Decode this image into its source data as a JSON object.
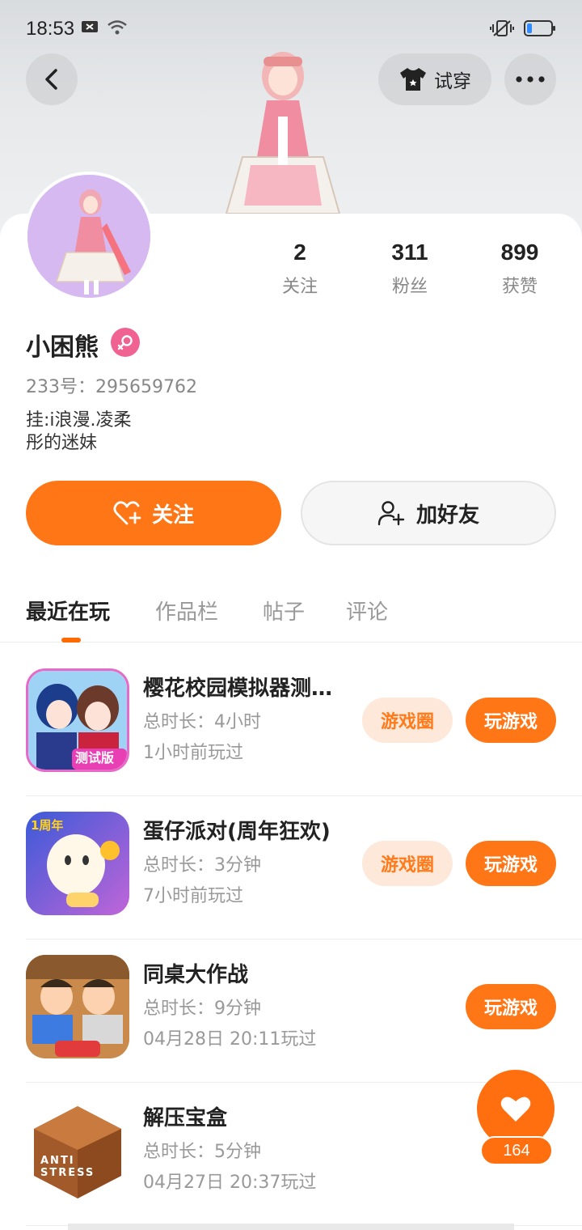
{
  "status": {
    "time": "18:53"
  },
  "header": {
    "try_on_label": "试穿"
  },
  "profile": {
    "stats": [
      {
        "num": "2",
        "label": "关注"
      },
      {
        "num": "311",
        "label": "粉丝"
      },
      {
        "num": "899",
        "label": "获赞"
      }
    ],
    "name": "小困熊",
    "uid": "233号：295659762",
    "bio_line1": "挂:i浪漫.凌柔",
    "bio_line2": "彤的迷妹",
    "follow_label": "关注",
    "add_friend_label": "加好友"
  },
  "tabs": [
    "最近在玩",
    "作品栏",
    "帖子",
    "评论"
  ],
  "games": [
    {
      "title": "樱花校园模拟器测试版",
      "duration": "总时长：4小时",
      "last_played": "1小时前玩过",
      "circle": "游戏圈",
      "play": "玩游戏",
      "icon_badge": "测试版"
    },
    {
      "title": "蛋仔派对(周年狂欢)",
      "duration": "总时长：3分钟",
      "last_played": "7小时前玩过",
      "circle": "游戏圈",
      "play": "玩游戏",
      "icon_badge": "1周年"
    },
    {
      "title": "同桌大作战",
      "duration": "总时长：9分钟",
      "last_played": "04月28日 20:11玩过",
      "circle": "",
      "play": "玩游戏",
      "icon_badge": ""
    },
    {
      "title": "解压宝盒",
      "duration": "总时长：5分钟",
      "last_played": "04月27日 20:37玩过",
      "circle": "",
      "play": "",
      "icon_badge": "ANTI STRESS"
    }
  ],
  "like_count": "164",
  "colors": {
    "accent": "#ff7616",
    "accent_light": "#fde8d9",
    "gender": "#f06292"
  }
}
